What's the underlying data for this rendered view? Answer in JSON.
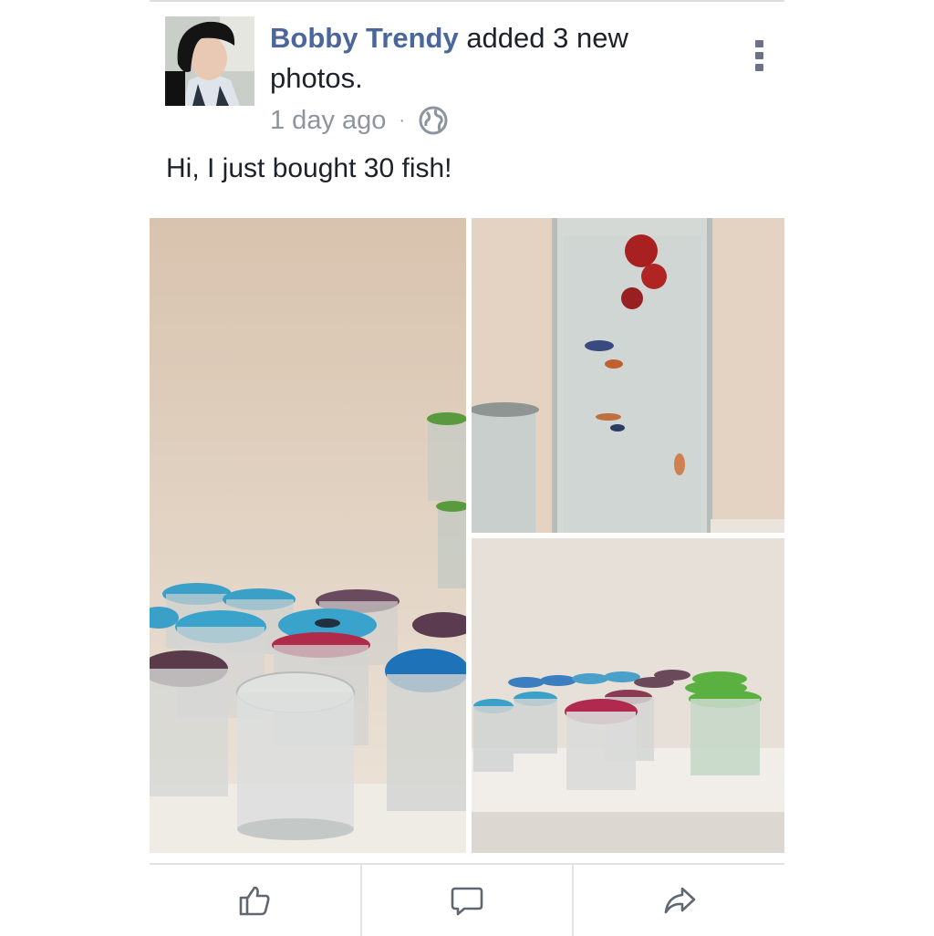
{
  "post": {
    "author": "Bobby Trendy",
    "action_text": " added 3 new photos.",
    "timestamp": "1 day ago",
    "separator": "·",
    "privacy_icon": "globe-icon",
    "menu_icon": "more-vertical-icon",
    "text": "Hi, I just bought 30 fish!",
    "photo_count": 3
  },
  "actions": {
    "like_icon": "thumbs-up-icon",
    "comment_icon": "comment-icon",
    "share_icon": "share-arrow-icon"
  },
  "colors": {
    "author_link": "#4b669c",
    "meta_text": "#8d949e",
    "body_text": "#1d2129",
    "divider": "#e1e2e6"
  }
}
